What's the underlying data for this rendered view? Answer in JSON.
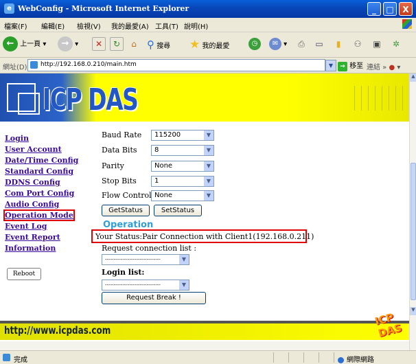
{
  "window": {
    "title": "WebConfig - Microsoft Internet Explorer",
    "controls": {
      "minimize": "_",
      "maximize": "□",
      "close": "X"
    }
  },
  "menubar": [
    "檔案(F)",
    "編輯(E)",
    "檢視(V)",
    "我的最愛(A)",
    "工具(T)",
    "說明(H)"
  ],
  "toolbar": {
    "back_label": "上一頁",
    "search_label": "搜尋",
    "favorites_label": "我的最愛"
  },
  "address": {
    "label": "網址(D)",
    "url": "http://192.168.0.210/main.htm",
    "go_label": "移至",
    "links_label": "連結"
  },
  "banner": {
    "logo_text": "ICP DAS"
  },
  "nav": {
    "items": [
      "Login",
      "User Account",
      "Date/Time Config",
      "Standard Config",
      "DDNS Config",
      "Com Port Config",
      "Audio Config",
      "Operation Mode",
      "Event Log",
      "Event Report",
      "Information"
    ],
    "active": "Operation Mode",
    "reboot_label": "Reboot"
  },
  "form": {
    "fields": [
      {
        "label": "Baud Rate",
        "value": "115200"
      },
      {
        "label": "Data Bits",
        "value": "8"
      },
      {
        "label": "Parity",
        "value": "None"
      },
      {
        "label": "Stop Bits",
        "value": "1"
      },
      {
        "label": "Flow Control",
        "value": "None"
      }
    ],
    "get_status_label": "GetStatus",
    "set_status_label": "SetStatus",
    "operation_title": "Operation",
    "status_text": "Your Status:Pair Connection with Client1(192.168.0.211)",
    "request_label": "Request connection list :",
    "request_value": "--------------------------------",
    "login_label": "Login list:",
    "login_value": "--------------------------------",
    "request_break_label": "Request Break !"
  },
  "footer": {
    "url_text": "http://www.icpdas.com",
    "mini_logo": "ICP DAS"
  },
  "statusbar": {
    "done": "完成",
    "zone": "網際網路"
  },
  "colors": {
    "nav_link": "#3a0a9a",
    "highlight": "#e00000",
    "operation_title": "#2e9fd8",
    "banner_yellow": "#ffff00"
  }
}
